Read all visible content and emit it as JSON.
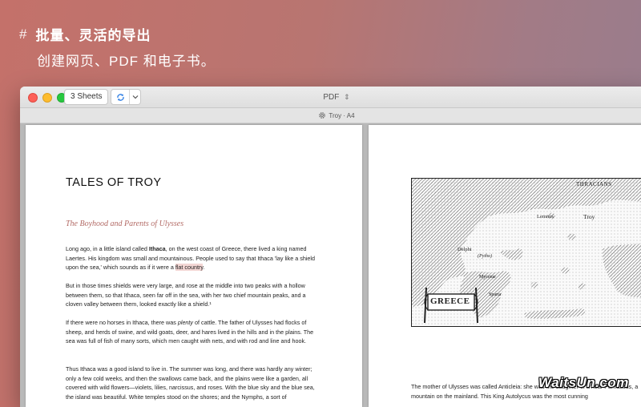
{
  "promo": {
    "icon": "#",
    "line1": "批量、灵活的导出",
    "line2": "创建网页、PDF 和电子书。"
  },
  "toolbar": {
    "sheets_label": "3 Sheets",
    "format_label": "PDF",
    "format_updown": "⌃⌄"
  },
  "subbar": {
    "label": "Troy · A4"
  },
  "left_page": {
    "book_title": "TALES OF TROY",
    "chapter_title": "The Boyhood and Parents of Ulysses",
    "p1_a": "Long ago, in a little island called ",
    "p1_bold": "Ithaca",
    "p1_b": ", on the west coast of Greece, there lived a king named Laertes. His kingdom was small and mountainous. People used to say that Ithaca 'lay like a shield upon the sea,' which sounds as if it were a ",
    "p1_hl": "flat country",
    "p1_c": ".",
    "p2": "But in those times shields were very large, and rose at the middle into two peaks with a hollow between them, so that Ithaca, seen far off in the sea, with her two chief mountain peaks, and a cloven valley between them, looked exactly like a shield.¹",
    "p3_a": "If there were no horses in Ithaca, there was ",
    "p3_em": "plenty",
    "p3_b": " of cattle. The father of Ulysses had flocks of sheep, and herds of swine, and wild goats, deer, and hares lived in the hills and in the plains. The sea was full of fish of many sorts, which men caught with nets, and with rod and line and hook.",
    "p4": "Thus Ithaca was a good island to live in. The summer was long, and there was hardly any winter; only a few cold weeks, and then the swallows came back, and the plains were like a garden, all covered with wild flowers—violets, lilies, narcissus, and roses. With the blue sky and the blue sea, the island was beautiful. White temples stood on the shores; and the Nymphs, a sort of"
  },
  "right_page": {
    "map_labels": {
      "thracians": "THRACIANS",
      "troy": "Troy",
      "lemnos": "Lemnos",
      "delphi": "Delphi",
      "pytho": "(Pytho)",
      "mycenae": "Mycenæ",
      "sparta": "Sparta",
      "greece": "GREECE"
    },
    "caption": "The mother of Ulysses was called Anticleia: she was the daughter of a near Parnassus, a mountain on the mainland. This King Autolycus was the most cunning"
  },
  "watermark": "WaitsUn.com",
  "colors": {
    "background_start": "#c4716a",
    "background_end": "#977d8e",
    "chapter_accent": "#b36b66",
    "highlight": "#f3d6d4",
    "close": "#fd5f57",
    "minimize": "#fdbc2e",
    "maximize": "#28c840"
  },
  "icons": {
    "refresh": "refresh-icon",
    "dropdown": "chevron-down-icon",
    "settings": "gear-icon"
  }
}
